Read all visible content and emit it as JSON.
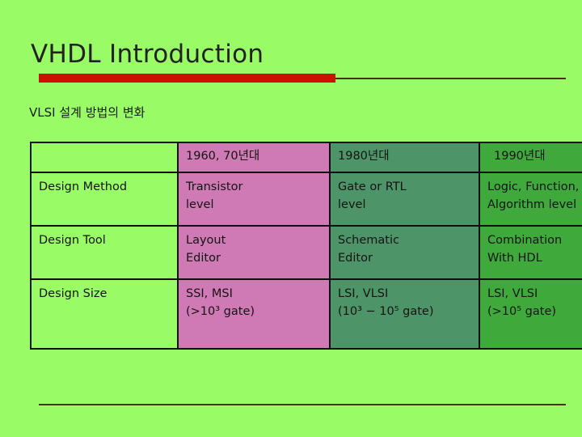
{
  "slide": {
    "title": "VHDL Introduction",
    "subtitle": "VLSI 설계 방법의 변화",
    "accent_bar_color": "#cc1100",
    "rule_color": "#4a2f10",
    "background_color": "#99fb65"
  },
  "table": {
    "columns": [
      {
        "header": "",
        "color": "#99fb65"
      },
      {
        "header": "1960, 70년대",
        "color": "#cf7ab4"
      },
      {
        "header": "1980년대",
        "color": "#4d9468"
      },
      {
        "header": "1990년대",
        "color": "#3fa93c"
      }
    ],
    "rows": [
      {
        "label": "Design Method",
        "c1_line1": "Transistor",
        "c1_line2": "level",
        "c2_line1": "Gate or RTL",
        "c2_line2": "level",
        "c3_line1": "Logic, Function,",
        "c3_line2": "Algorithm level"
      },
      {
        "label": "Design Tool",
        "c1_line1": "Layout",
        "c1_line2": "Editor",
        "c2_line1": "Schematic",
        "c2_line2": "Editor",
        "c3_line1": "Combination",
        "c3_line2": "With HDL"
      },
      {
        "label": "Design Size",
        "c1_line1": "SSI, MSI",
        "c1_line2": "(>10³ gate)",
        "c2_line1": "LSI, VLSI",
        "c2_line2": "(10³ − 10⁵ gate)",
        "c3_line1": "LSI, VLSI",
        "c3_line2": "(>10⁵ gate)"
      }
    ]
  }
}
